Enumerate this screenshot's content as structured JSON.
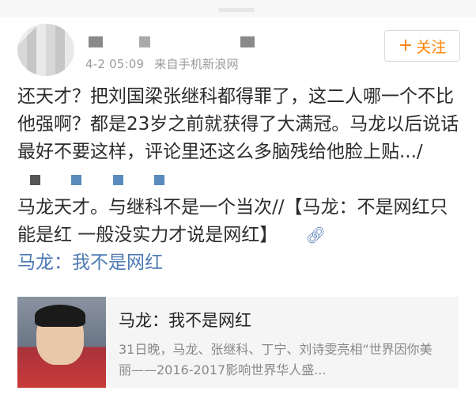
{
  "post": {
    "timestamp": "4-2 05:09",
    "source": "来自手机新浪网",
    "follow_label": "关注",
    "paragraphs": [
      "还天才？把刘国梁张继科都得罪了，这二人哪一个不比他强啊？都是23岁之前就获得了大满冠。马龙以后说话最好不要这样，评论里还这么多脑残给他脸上贴.../",
      "马龙天才。与继科不是一个当次//【马龙：不是网红只能是红 一般没实力才说是网红】"
    ],
    "topic_link": "马龙：我不是网红"
  },
  "card": {
    "title": "马龙：我不是网红",
    "description": "31日晚，马龙、张继科、丁宁、刘诗雯亮相“世界因你美丽——2016-2017影响世界华人盛..."
  },
  "icons": {
    "follow": "plus-icon",
    "link": "link-icon"
  },
  "colors": {
    "accent": "#ff8200",
    "link": "#4d7ab4"
  }
}
